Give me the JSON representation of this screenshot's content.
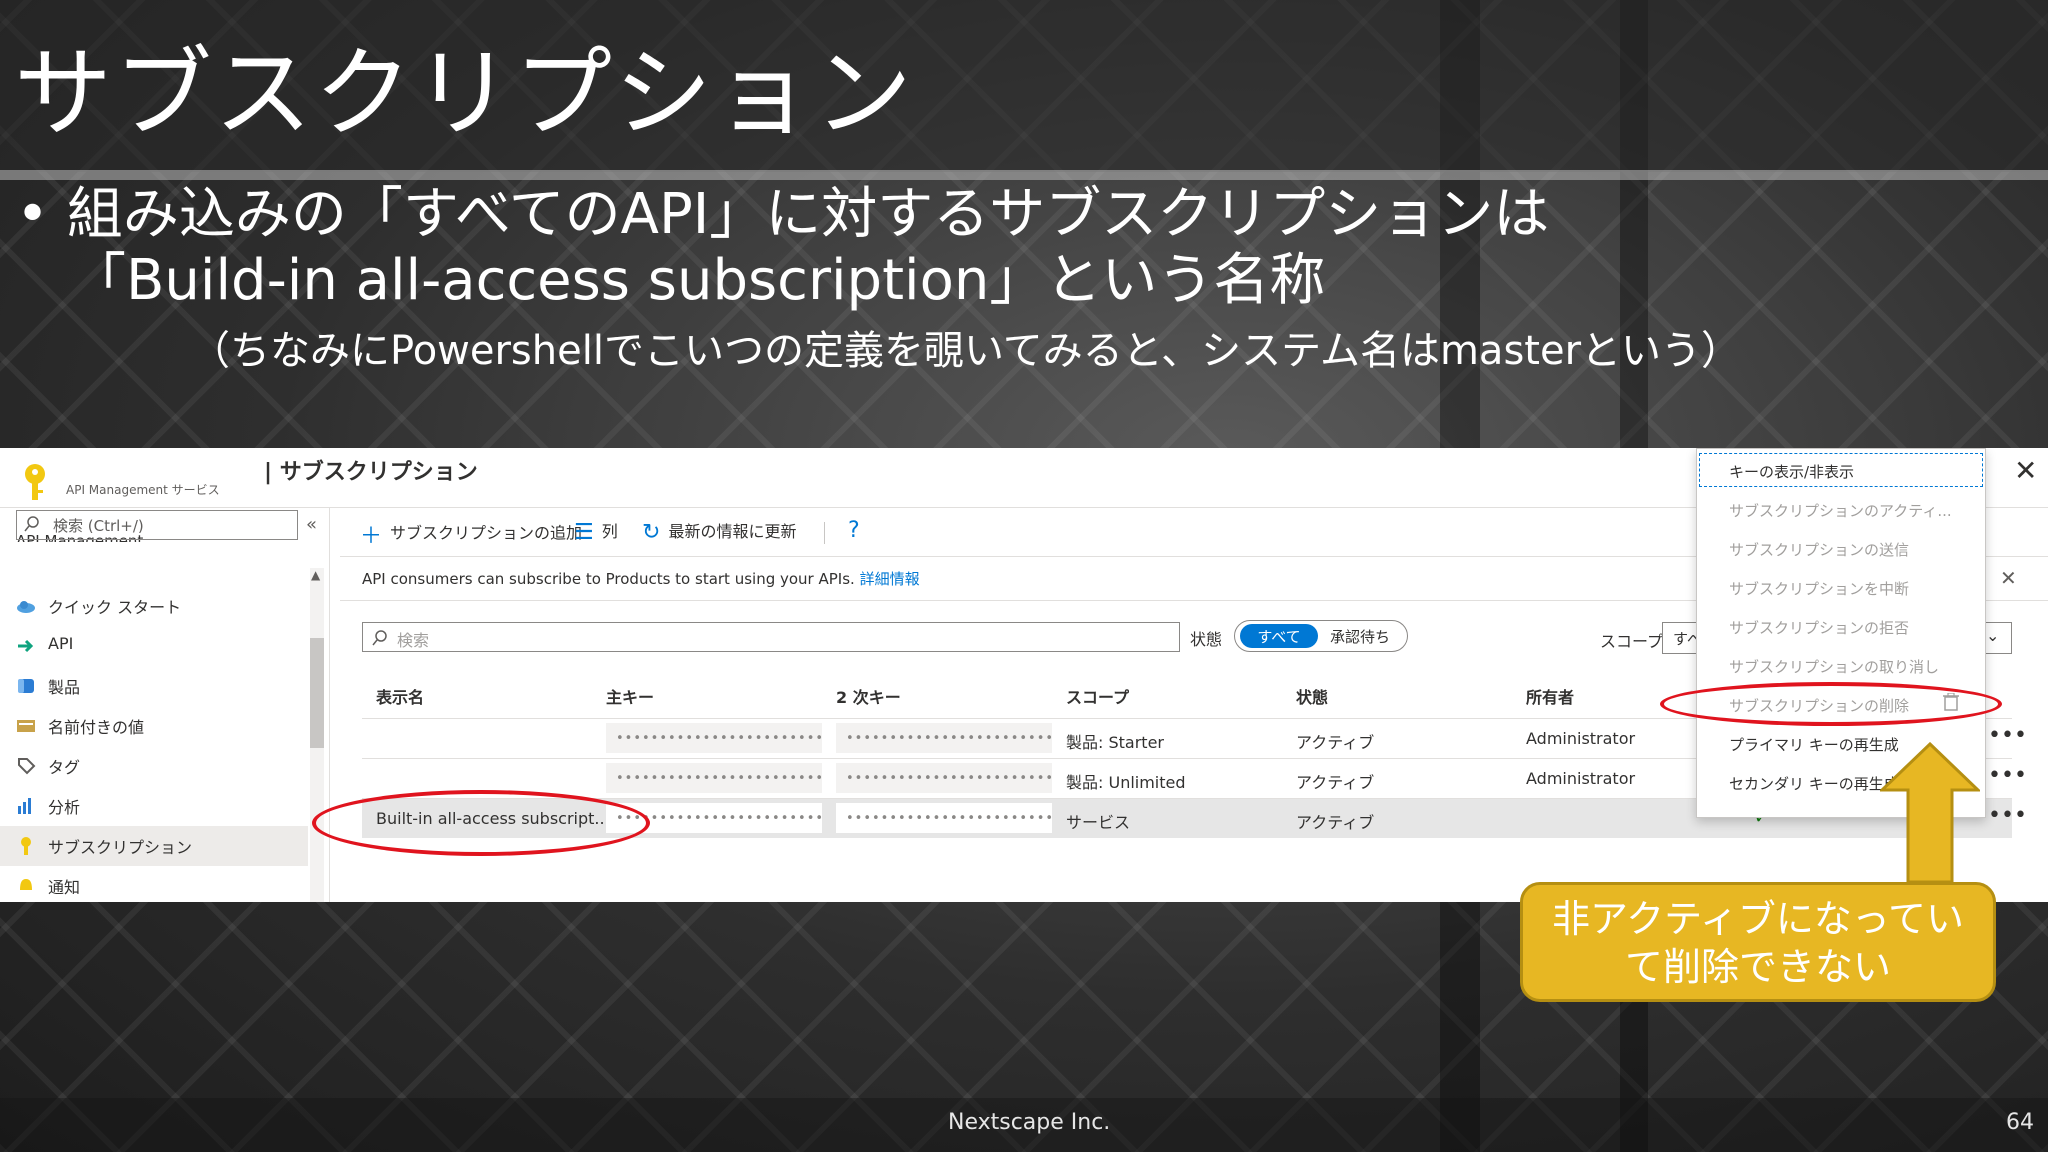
{
  "slide": {
    "title": "サブスクリプション",
    "bullet_line1": "• 組み込みの「すべてのAPI」に対するサブスクリプションは",
    "bullet_line2": "「Build-in all-access subscription」という名称",
    "note": "（ちなみにPowershellでこいつの定義を覗いてみると、システム名はmasterという）",
    "footer_company": "Nextscape Inc.",
    "page_number": "64"
  },
  "portal": {
    "service_label": "API Management サービス",
    "title": "| サブスクリプション",
    "close_label": "✕",
    "nav": {
      "search_placeholder": "検索 (Ctrl+/)",
      "collapse_label": "«",
      "cut_label": "API Management",
      "items": [
        {
          "label": "クイック スタート",
          "icon": "cloud-icon",
          "active": false
        },
        {
          "label": "API",
          "icon": "api-arrow-icon",
          "active": false
        },
        {
          "label": "製品",
          "icon": "product-cube-icon",
          "active": false
        },
        {
          "label": "名前付きの値",
          "icon": "named-values-icon",
          "active": false
        },
        {
          "label": "タグ",
          "icon": "tag-icon",
          "active": false
        },
        {
          "label": "分析",
          "icon": "chart-icon",
          "active": false
        },
        {
          "label": "サブスクリプション",
          "icon": "key-icon",
          "active": true
        },
        {
          "label": "通知",
          "icon": "bell-icon",
          "active": false
        }
      ]
    },
    "toolbar": {
      "add_label": "サブスクリプションの追加",
      "columns_label": "列",
      "refresh_label": "最新の情報に更新",
      "help_label": "?"
    },
    "info": {
      "text": "API consumers can subscribe to Products to start using your APIs. ",
      "link": "詳細情報",
      "close": "✕"
    },
    "filter": {
      "search_placeholder": "検索",
      "state_label": "状態",
      "toggle_all": "すべて",
      "toggle_pending": "承認待ち",
      "scope_label": "スコープ",
      "scope_value": "すべ"
    },
    "table": {
      "headers": [
        "表示名",
        "主キー",
        "2 次キー",
        "スコープ",
        "状態",
        "所有者"
      ],
      "rows": [
        {
          "name": "",
          "primary": "••••••••••••••••••••••••...",
          "secondary": "••••••••••••••••••••••••...",
          "scope": "製品: Starter",
          "state": "アクティブ",
          "owner": "Administrator"
        },
        {
          "name": "",
          "primary": "••••••••••••••••••••••••...",
          "secondary": "••••••••••••••••••••••••...",
          "scope": "製品: Unlimited",
          "state": "アクティブ",
          "owner": "Administrator"
        },
        {
          "name": "Built-in all-access subscript...",
          "primary": "••••••••••••••••••••••••...",
          "secondary": "••••••••••••••••••••••••...",
          "scope": "サービス",
          "state": "アクティブ",
          "owner": ""
        }
      ],
      "more_label": "•••",
      "check_label": "✓"
    },
    "context_menu": [
      {
        "label": "キーの表示/非表示",
        "enabled": true
      },
      {
        "label": "サブスクリプションのアクティ...",
        "enabled": false
      },
      {
        "label": "サブスクリプションの送信",
        "enabled": false
      },
      {
        "label": "サブスクリプションを中断",
        "enabled": false
      },
      {
        "label": "サブスクリプションの拒否",
        "enabled": false
      },
      {
        "label": "サブスクリプションの取り消し",
        "enabled": false
      },
      {
        "label": "サブスクリプションの削除",
        "enabled": false
      },
      {
        "label": "プライマリ キーの再生成",
        "enabled": true
      },
      {
        "label": "セカンダリ キーの再生成",
        "enabled": true
      }
    ]
  },
  "callout": {
    "line1": "非アクティブになってい",
    "line2": "て削除できない"
  },
  "colors": {
    "accent": "#0078d4",
    "highlight_red": "#e0141e",
    "callout_yellow": "#e7b723"
  }
}
